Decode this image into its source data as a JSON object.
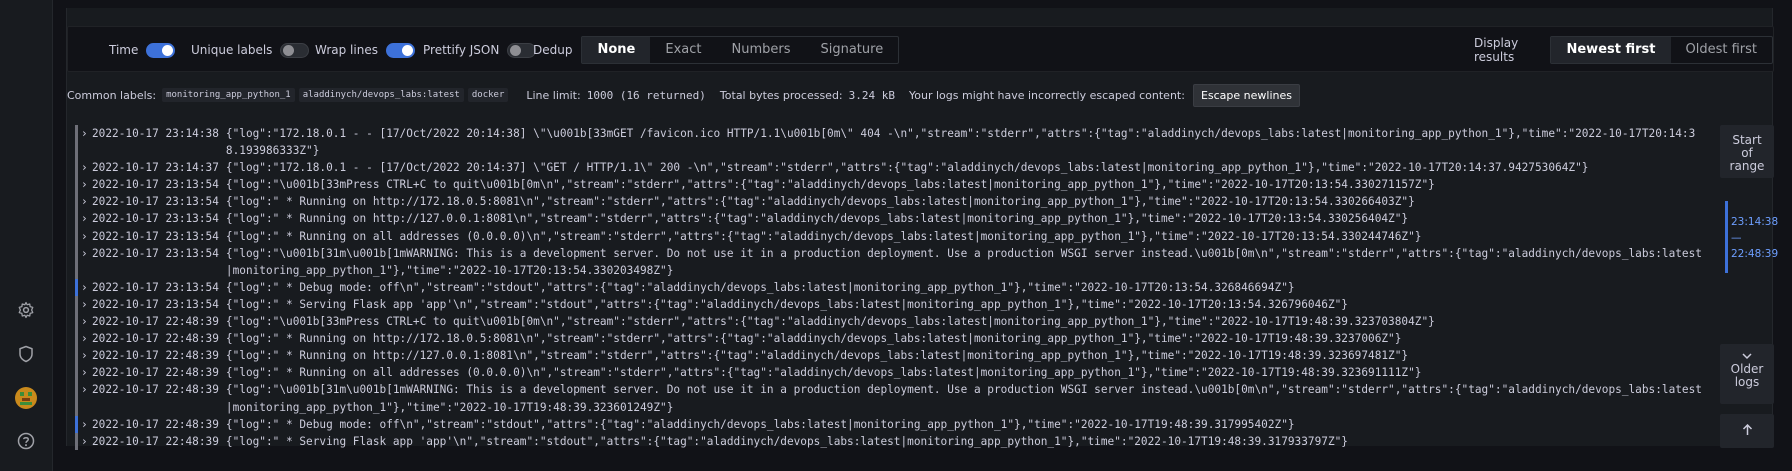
{
  "sidebar": {
    "icons": [
      "gear-icon",
      "shield-icon",
      "avatar",
      "help-icon"
    ]
  },
  "controls": {
    "time_label": "Time",
    "unique_labels_label": "Unique labels",
    "wrap_lines_label": "Wrap lines",
    "prettify_label": "Prettify JSON",
    "dedup_label": "Dedup",
    "dedup_options": [
      "None",
      "Exact",
      "Numbers",
      "Signature"
    ],
    "dedup_selected": "None",
    "display_results_label": "Display results",
    "order_options": [
      "Newest first",
      "Oldest first"
    ],
    "order_selected": "Newest first"
  },
  "meta": {
    "common_labels_label": "Common labels:",
    "common_labels": [
      "monitoring_app_python_1",
      "aladdinych/devops_labs:latest",
      "docker"
    ],
    "line_limit_label": "Line limit:",
    "line_limit_value": "1000 (16 returned)",
    "bytes_label": "Total bytes processed:",
    "bytes_value": "3.24 kB",
    "escape_warning": "Your logs might have incorrectly escaped content:",
    "escape_button": "Escape newlines"
  },
  "logs": [
    {
      "ts": "2022-10-17 23:14:38",
      "level": "unknown",
      "msg": "{\"log\":\"172.18.0.1 - - [17/Oct/2022 20:14:38] \\\"\\u001b[33mGET /favicon.ico HTTP/1.1\\u001b[0m\\\" 404 -\\n\",\"stream\":\"stderr\",\"attrs\":{\"tag\":\"aladdinych/devops_labs:latest|monitoring_app_python_1\"},\"time\":\"2022-10-17T20:14:38.193986333Z\"}"
    },
    {
      "ts": "2022-10-17 23:14:37",
      "level": "unknown",
      "msg": "{\"log\":\"172.18.0.1 - - [17/Oct/2022 20:14:37] \\\"GET / HTTP/1.1\\\" 200 -\\n\",\"stream\":\"stderr\",\"attrs\":{\"tag\":\"aladdinych/devops_labs:latest|monitoring_app_python_1\"},\"time\":\"2022-10-17T20:14:37.942753064Z\"}"
    },
    {
      "ts": "2022-10-17 23:13:54",
      "level": "unknown",
      "msg": "{\"log\":\"\\u001b[33mPress CTRL+C to quit\\u001b[0m\\n\",\"stream\":\"stderr\",\"attrs\":{\"tag\":\"aladdinych/devops_labs:latest|monitoring_app_python_1\"},\"time\":\"2022-10-17T20:13:54.330271157Z\"}"
    },
    {
      "ts": "2022-10-17 23:13:54",
      "level": "unknown",
      "msg": "{\"log\":\" * Running on http://172.18.0.5:8081\\n\",\"stream\":\"stderr\",\"attrs\":{\"tag\":\"aladdinych/devops_labs:latest|monitoring_app_python_1\"},\"time\":\"2022-10-17T20:13:54.330266403Z\"}"
    },
    {
      "ts": "2022-10-17 23:13:54",
      "level": "unknown",
      "msg": "{\"log\":\" * Running on http://127.0.0.1:8081\\n\",\"stream\":\"stderr\",\"attrs\":{\"tag\":\"aladdinych/devops_labs:latest|monitoring_app_python_1\"},\"time\":\"2022-10-17T20:13:54.330256404Z\"}"
    },
    {
      "ts": "2022-10-17 23:13:54",
      "level": "unknown",
      "msg": "{\"log\":\" * Running on all addresses (0.0.0.0)\\n\",\"stream\":\"stderr\",\"attrs\":{\"tag\":\"aladdinych/devops_labs:latest|monitoring_app_python_1\"},\"time\":\"2022-10-17T20:13:54.330244746Z\"}"
    },
    {
      "ts": "2022-10-17 23:13:54",
      "level": "unknown",
      "msg": "{\"log\":\"\\u001b[31m\\u001b[1mWARNING: This is a development server. Do not use it in a production deployment. Use a production WSGI server instead.\\u001b[0m\\n\",\"stream\":\"stderr\",\"attrs\":{\"tag\":\"aladdinych/devops_labs:latest|monitoring_app_python_1\"},\"time\":\"2022-10-17T20:13:54.330203498Z\"}"
    },
    {
      "ts": "2022-10-17 23:13:54",
      "level": "info",
      "msg": "{\"log\":\" * Debug mode: off\\n\",\"stream\":\"stdout\",\"attrs\":{\"tag\":\"aladdinych/devops_labs:latest|monitoring_app_python_1\"},\"time\":\"2022-10-17T20:13:54.326846694Z\"}"
    },
    {
      "ts": "2022-10-17 23:13:54",
      "level": "unknown",
      "msg": "{\"log\":\" * Serving Flask app 'app'\\n\",\"stream\":\"stdout\",\"attrs\":{\"tag\":\"aladdinych/devops_labs:latest|monitoring_app_python_1\"},\"time\":\"2022-10-17T20:13:54.326796046Z\"}"
    },
    {
      "ts": "2022-10-17 22:48:39",
      "level": "unknown",
      "msg": "{\"log\":\"\\u001b[33mPress CTRL+C to quit\\u001b[0m\\n\",\"stream\":\"stderr\",\"attrs\":{\"tag\":\"aladdinych/devops_labs:latest|monitoring_app_python_1\"},\"time\":\"2022-10-17T19:48:39.323703804Z\"}"
    },
    {
      "ts": "2022-10-17 22:48:39",
      "level": "unknown",
      "msg": "{\"log\":\" * Running on http://172.18.0.5:8081\\n\",\"stream\":\"stderr\",\"attrs\":{\"tag\":\"aladdinych/devops_labs:latest|monitoring_app_python_1\"},\"time\":\"2022-10-17T19:48:39.3237006Z\"}"
    },
    {
      "ts": "2022-10-17 22:48:39",
      "level": "unknown",
      "msg": "{\"log\":\" * Running on http://127.0.0.1:8081\\n\",\"stream\":\"stderr\",\"attrs\":{\"tag\":\"aladdinych/devops_labs:latest|monitoring_app_python_1\"},\"time\":\"2022-10-17T19:48:39.323697481Z\"}"
    },
    {
      "ts": "2022-10-17 22:48:39",
      "level": "unknown",
      "msg": "{\"log\":\" * Running on all addresses (0.0.0.0)\\n\",\"stream\":\"stderr\",\"attrs\":{\"tag\":\"aladdinych/devops_labs:latest|monitoring_app_python_1\"},\"time\":\"2022-10-17T19:48:39.323691111Z\"}"
    },
    {
      "ts": "2022-10-17 22:48:39",
      "level": "unknown",
      "msg": "{\"log\":\"\\u001b[31m\\u001b[1mWARNING: This is a development server. Do not use it in a production deployment. Use a production WSGI server instead.\\u001b[0m\\n\",\"stream\":\"stderr\",\"attrs\":{\"tag\":\"aladdinych/devops_labs:latest|monitoring_app_python_1\"},\"time\":\"2022-10-17T19:48:39.323601249Z\"}"
    },
    {
      "ts": "2022-10-17 22:48:39",
      "level": "info",
      "msg": "{\"log\":\" * Debug mode: off\\n\",\"stream\":\"stdout\",\"attrs\":{\"tag\":\"aladdinych/devops_labs:latest|monitoring_app_python_1\"},\"time\":\"2022-10-17T19:48:39.317995402Z\"}"
    },
    {
      "ts": "2022-10-17 22:48:39",
      "level": "unknown",
      "msg": "{\"log\":\" * Serving Flask app 'app'\\n\",\"stream\":\"stdout\",\"attrs\":{\"tag\":\"aladdinych/devops_labs:latest|monitoring_app_python_1\"},\"time\":\"2022-10-17T19:48:39.317933797Z\"}"
    }
  ],
  "navigation": {
    "start_of_range": "Start of range",
    "range_start": "23:14:38",
    "range_dash": "—",
    "range_end": "22:48:39",
    "older_logs": "Older logs",
    "scroll_top_icon": "arrow-up-icon"
  },
  "colors": {
    "accent": "#3d71d9",
    "background": "#111217",
    "panel": "#181b1f"
  }
}
